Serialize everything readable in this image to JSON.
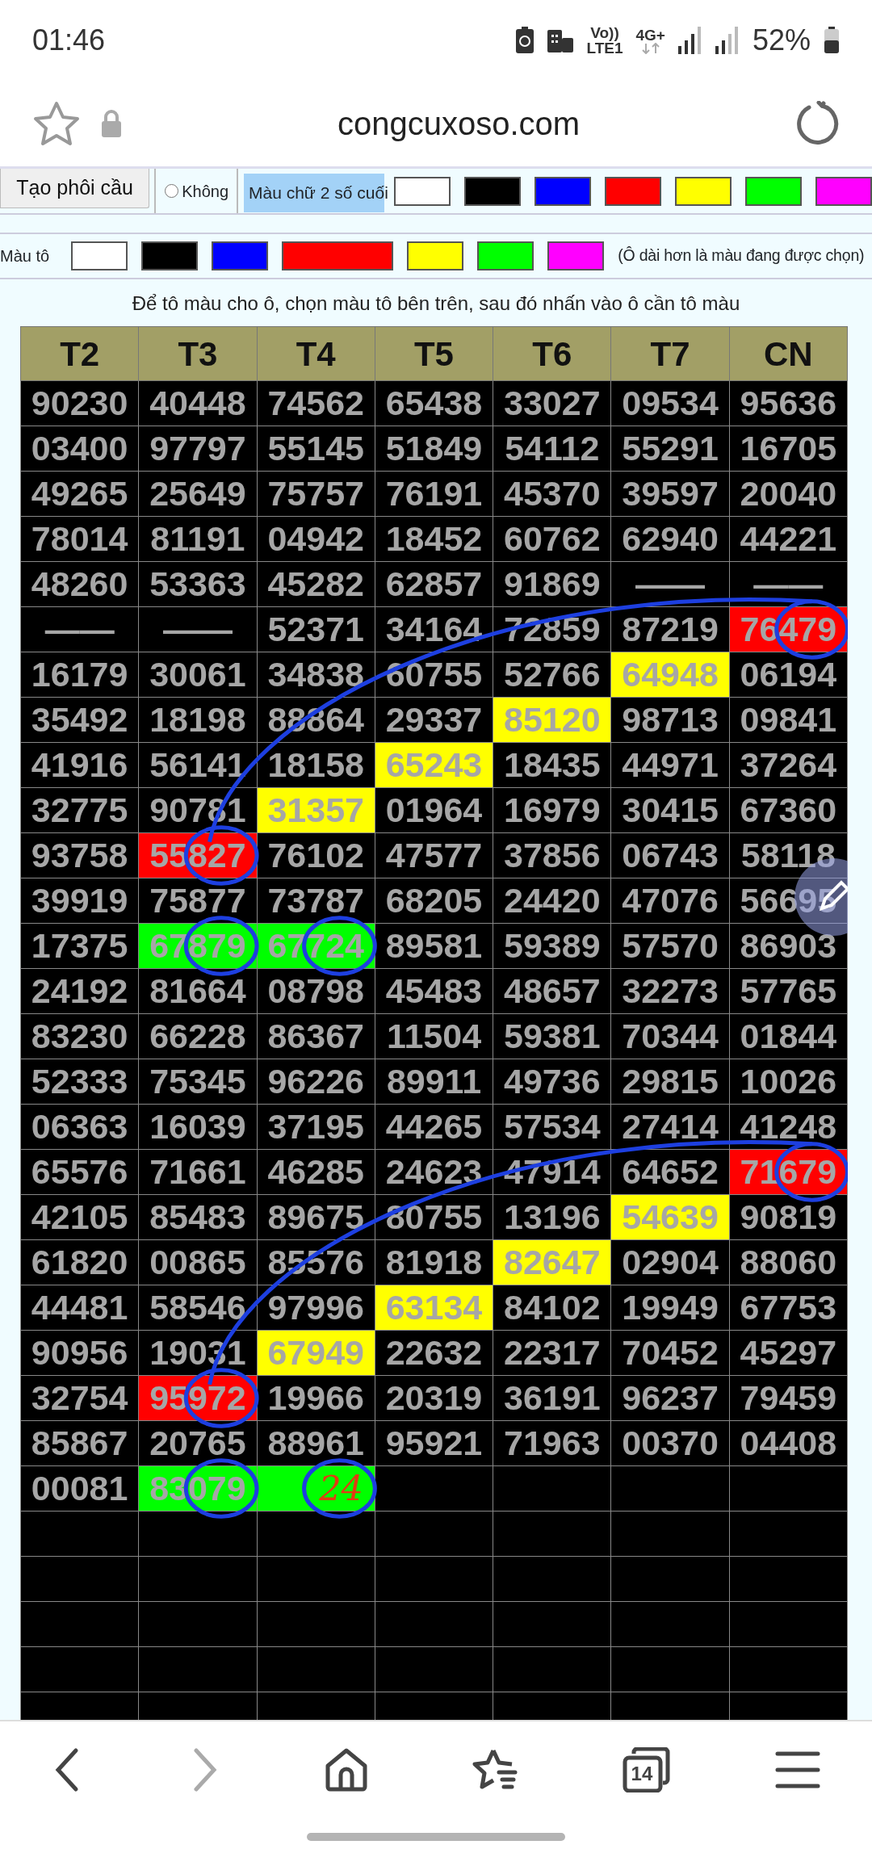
{
  "status_bar": {
    "time": "01:46",
    "volte": "Vo))",
    "network": "LTE1",
    "data": "4G+",
    "battery": "52%"
  },
  "browser": {
    "url": "congcuxoso.com"
  },
  "toolbar": {
    "button": "Tạo phôi cầu",
    "radio": {
      "label": "Không",
      "checked": false
    },
    "text_color_label": "Màu chữ 2 số cuối",
    "text_colors": [
      {
        "color": "#ffffff",
        "selected": false
      },
      {
        "color": "#000000",
        "selected": false
      },
      {
        "color": "#0000ff",
        "selected": false
      },
      {
        "color": "#ff0000",
        "selected": false
      },
      {
        "color": "#ffff00",
        "selected": false
      },
      {
        "color": "#00ff00",
        "selected": false
      },
      {
        "color": "#ff00ff",
        "selected": false
      }
    ],
    "fill_label": "Màu tô",
    "fill_colors": [
      {
        "color": "#ffffff",
        "selected": false
      },
      {
        "color": "#000000",
        "selected": false
      },
      {
        "color": "#0000ff",
        "selected": false
      },
      {
        "color": "#ff0000",
        "selected": true
      },
      {
        "color": "#ffff00",
        "selected": false
      },
      {
        "color": "#00ff00",
        "selected": false
      },
      {
        "color": "#ff00ff",
        "selected": false
      }
    ],
    "fill_hint": "(Ô dài hơn là màu đang được chọn)"
  },
  "instruction": "Để tô màu cho ô, chọn màu tô bên trên, sau đó nhấn vào ô cần tô màu",
  "table": {
    "columns": [
      "T2",
      "T3",
      "T4",
      "T5",
      "T6",
      "T7",
      "CN"
    ],
    "rows": [
      [
        "90230",
        "40448",
        "74562",
        "65438",
        "33027",
        "09534",
        "95636"
      ],
      [
        "03400",
        "97797",
        "55145",
        "51849",
        "54112",
        "55291",
        "16705"
      ],
      [
        "49265",
        "25649",
        "75757",
        "76191",
        "45370",
        "39597",
        "20040"
      ],
      [
        "78014",
        "81191",
        "04942",
        "18452",
        "60762",
        "62940",
        "44221"
      ],
      [
        "48260",
        "53363",
        "45282",
        "62857",
        "91869",
        "——",
        "——"
      ],
      [
        "——",
        "——",
        "52371",
        "34164",
        "72859",
        "87219",
        {
          "text": "76479",
          "color": "#ff0000",
          "circled": true
        }
      ],
      [
        "16179",
        "30061",
        "34838",
        "60755",
        "52766",
        {
          "text": "64948",
          "color": "#ffff00"
        },
        "06194"
      ],
      [
        "35492",
        "18198",
        "88864",
        "29337",
        {
          "text": "85120",
          "color": "#ffff00"
        },
        "98713",
        "09841"
      ],
      [
        "41916",
        "56141",
        "18158",
        {
          "text": "65243",
          "color": "#ffff00"
        },
        "18435",
        "44971",
        "37264"
      ],
      [
        "32775",
        "90781",
        {
          "text": "31357",
          "color": "#ffff00"
        },
        "01964",
        "16979",
        "30415",
        "67360"
      ],
      [
        "93758",
        {
          "text": "55827",
          "color": "#ff0000",
          "circled": true
        },
        "76102",
        "47577",
        "37856",
        "06743",
        "58118"
      ],
      [
        "39919",
        "75877",
        "73787",
        "68205",
        "24420",
        "47076",
        "56695"
      ],
      [
        "17375",
        {
          "text": "67879",
          "color": "#00ff00",
          "circled": true
        },
        {
          "text": "67724",
          "color": "#00ff00",
          "circled": true
        },
        "89581",
        "59389",
        "57570",
        "86903"
      ],
      [
        "24192",
        "81664",
        "08798",
        "45483",
        "48657",
        "32273",
        "57765"
      ],
      [
        "83230",
        "66228",
        "86367",
        "11504",
        "59381",
        "70344",
        "01844"
      ],
      [
        "52333",
        "75345",
        "96226",
        "89911",
        "49736",
        "29815",
        "10026"
      ],
      [
        "06363",
        "16039",
        "37195",
        "44265",
        "57534",
        "27414",
        "41248"
      ],
      [
        "65576",
        "71661",
        "46285",
        "24623",
        "47914",
        "64652",
        {
          "text": "71679",
          "color": "#ff0000",
          "circled": true
        }
      ],
      [
        "42105",
        "85483",
        "89675",
        "80755",
        "13196",
        {
          "text": "54639",
          "color": "#ffff00"
        },
        "90819"
      ],
      [
        "61820",
        "00865",
        "85576",
        "81918",
        {
          "text": "82647",
          "color": "#ffff00"
        },
        "02904",
        "88060"
      ],
      [
        "44481",
        "58546",
        "97996",
        {
          "text": "63134",
          "color": "#ffff00"
        },
        "84102",
        "19949",
        "67753"
      ],
      [
        "90956",
        "19031",
        {
          "text": "67949",
          "color": "#ffff00"
        },
        "22632",
        "22317",
        "70452",
        "45297"
      ],
      [
        "32754",
        {
          "text": "95972",
          "color": "#ff0000",
          "circled": true
        },
        "19966",
        "20319",
        "36191",
        "96237",
        "79459"
      ],
      [
        "85867",
        "20765",
        "88961",
        "95921",
        "71963",
        "00370",
        "04408"
      ],
      [
        "00081",
        {
          "text": "83079",
          "color": "#00ff00",
          "circled": true
        },
        {
          "text": "24",
          "kind": "handwritten",
          "color": "#00ff00",
          "circled": true
        }
      ]
    ]
  },
  "bottom_nav": {
    "items": [
      {
        "kind": "back",
        "disabled": false
      },
      {
        "kind": "forward",
        "disabled": true
      },
      {
        "kind": "home",
        "disabled": false
      },
      {
        "kind": "bookmarks",
        "disabled": false
      },
      {
        "kind": "tabs",
        "count": "14",
        "disabled": false
      },
      {
        "kind": "menu",
        "disabled": false
      }
    ]
  }
}
